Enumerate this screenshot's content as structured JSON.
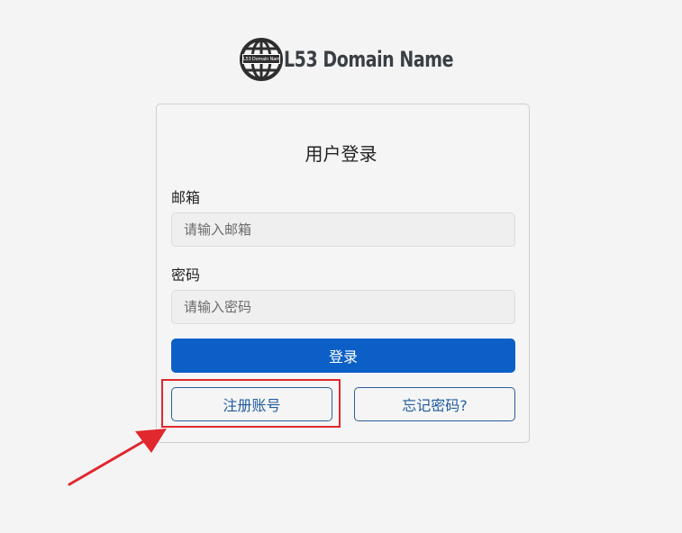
{
  "logo": {
    "badge_text": "L53 Domain Name",
    "text": "L53 Domain Name"
  },
  "login": {
    "title": "用户登录",
    "email_label": "邮箱",
    "email_placeholder": "请输入邮箱",
    "password_label": "密码",
    "password_placeholder": "请输入密码",
    "submit_label": "登录",
    "register_label": "注册账号",
    "forgot_label": "忘记密码?"
  },
  "colors": {
    "primary": "#0b5fc6",
    "annotation": "#e0282e",
    "background": "#f4f4f4"
  },
  "icons": {
    "logo": "globe-icon",
    "annotation": "red-arrow"
  }
}
